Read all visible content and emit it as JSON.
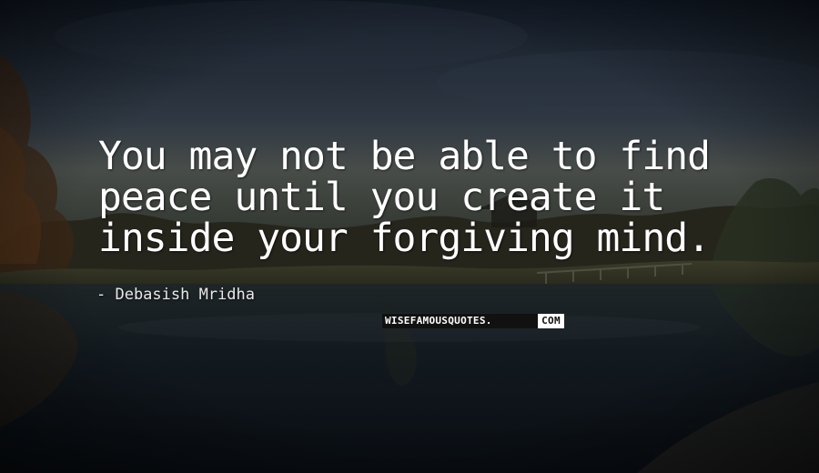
{
  "quote": {
    "lines": [
      "You may not be able to find",
      "peace until you create it",
      "inside your forgiving mind."
    ]
  },
  "author": {
    "text": "- Debasish Mridha"
  },
  "watermark": {
    "main": "WISEFAMOUSQUOTES.",
    "tld": "COM"
  },
  "colors": {
    "text": "#ffffff",
    "watermark_dark": "#111111",
    "watermark_light": "#ffffff"
  }
}
